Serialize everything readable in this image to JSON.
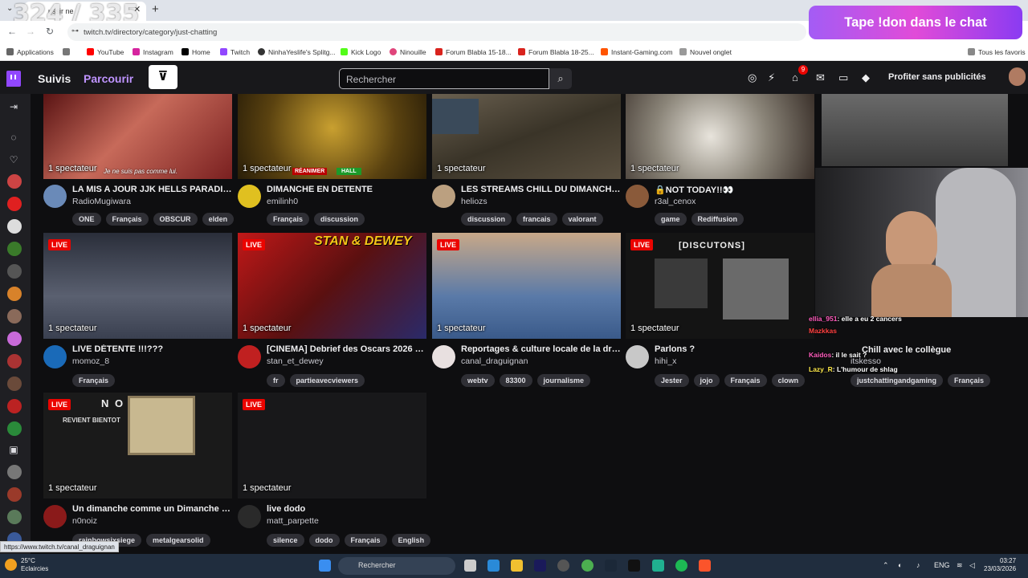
{
  "browser": {
    "tab_title": "ussir ne",
    "url": "twitch.tv/directory/category/just-chatting",
    "overlay_counter": "324 / 335",
    "bookmarks": [
      "Applications",
      "YouTube",
      "Instagram",
      "Home",
      "Twitch",
      "NinhaYeslife's Splitg...",
      "Kick Logo",
      "Ninouille",
      "Forum Blabla 15-18...",
      "Forum Blabla 18-25...",
      "Instant-Gaming.com",
      "Nouvel onglet",
      "Tous les favoris"
    ]
  },
  "donation": "Tape !don dans le chat",
  "nav": {
    "following": "Suivis",
    "browse": "Parcourir",
    "search_placeholder": "Rechercher",
    "notif_count": "9",
    "premium": "Profiter sans publicités"
  },
  "live_label": "LIVE",
  "cards": [
    {
      "viewers": "1 spectateur",
      "title": "LA MIS A JOUR JJK HELLS PARADISE",
      "name": "RadioMugiwara",
      "tags": [
        "ONE",
        "Français",
        "OBSCUR",
        "elden"
      ],
      "live": false
    },
    {
      "viewers": "1 spectateur",
      "title": "DIMANCHE EN DETENTE",
      "name": "emilinh0",
      "tags": [
        "Français",
        "discussion"
      ],
      "live": false
    },
    {
      "viewers": "1 spectateur",
      "title": "LES STREAMS CHILL DU DIMANCHE S...",
      "name": "heliozs",
      "tags": [
        "discussion",
        "francais",
        "valorant"
      ],
      "live": false
    },
    {
      "viewers": "1 spectateur",
      "title": "🔒NOT TODAY!!👀",
      "name": "r3al_cenox",
      "tags": [
        "game",
        "Rediffusion"
      ],
      "live": false
    },
    {
      "viewers": "1 spectateur",
      "title": "LIVE DÉTENTE !!!???",
      "name": "momoz_8",
      "tags": [
        "Français"
      ],
      "live": true
    },
    {
      "viewers": "1 spectateur",
      "title": "[CINEMA] Debrief des Oscars 2026 + ...",
      "name": "stan_et_dewey",
      "tags": [
        "fr",
        "partieavecviewers"
      ],
      "live": true
    },
    {
      "viewers": "1 spectateur",
      "title": "Reportages & culture locale de la drac...",
      "name": "canal_draguignan",
      "tags": [
        "webtv",
        "83300",
        "journalisme"
      ],
      "live": true
    },
    {
      "viewers": "1 spectateur",
      "title": "Parlons ?",
      "name": "hihi_x",
      "tags": [
        "Jester",
        "jojo",
        "Français",
        "clown"
      ],
      "live": true
    },
    {
      "viewers": "1 spectateur",
      "title": "Un dimanche comme un Dimanche - [...",
      "name": "n0noiz",
      "tags": [
        "rainbowsixsiege",
        "metalgearsolid"
      ],
      "live": true
    },
    {
      "viewers": "1 spectateur",
      "title": "live dodo",
      "name": "matt_parpette",
      "tags": [
        "silence",
        "dodo",
        "Français",
        "English"
      ],
      "live": true
    }
  ],
  "partial_card": {
    "viewers": "1 spectateur",
    "title": "Chill avec le collègue",
    "name": "itskesso",
    "tags": [
      "justchattingandgaming",
      "Français"
    ]
  },
  "thumb_text": {
    "jjk": "Je ne suis pas comme lui.",
    "reanimer": "RÉANIMER",
    "hall": "HALL",
    "stan": "STAN & DEWEY",
    "discutons": "[DISCUTONS]",
    "noiz": "N O I Z",
    "revient": "REVIENT BIENTOT"
  },
  "chat": [
    {
      "user": "ellia_951",
      "msg": "elle a eu 2 cancers",
      "color": "#ff5cbd"
    },
    {
      "user": "Mazkkas",
      "msg": "",
      "color": "#ff4040"
    },
    {
      "user": "Kaidos",
      "msg": "il le sait ?",
      "color": "#ff5cbd"
    },
    {
      "user": "Lazy_R",
      "msg": "L'humour de shlag",
      "color": "#ffea4a"
    }
  ],
  "status_link": "https://www.twitch.tv/canal_draguignan",
  "taskbar": {
    "search": "Rechercher",
    "temp": "25°C",
    "weather": "Eclaircies",
    "lang": "ENG",
    "time": "03:27",
    "date": "23/03/2026"
  }
}
